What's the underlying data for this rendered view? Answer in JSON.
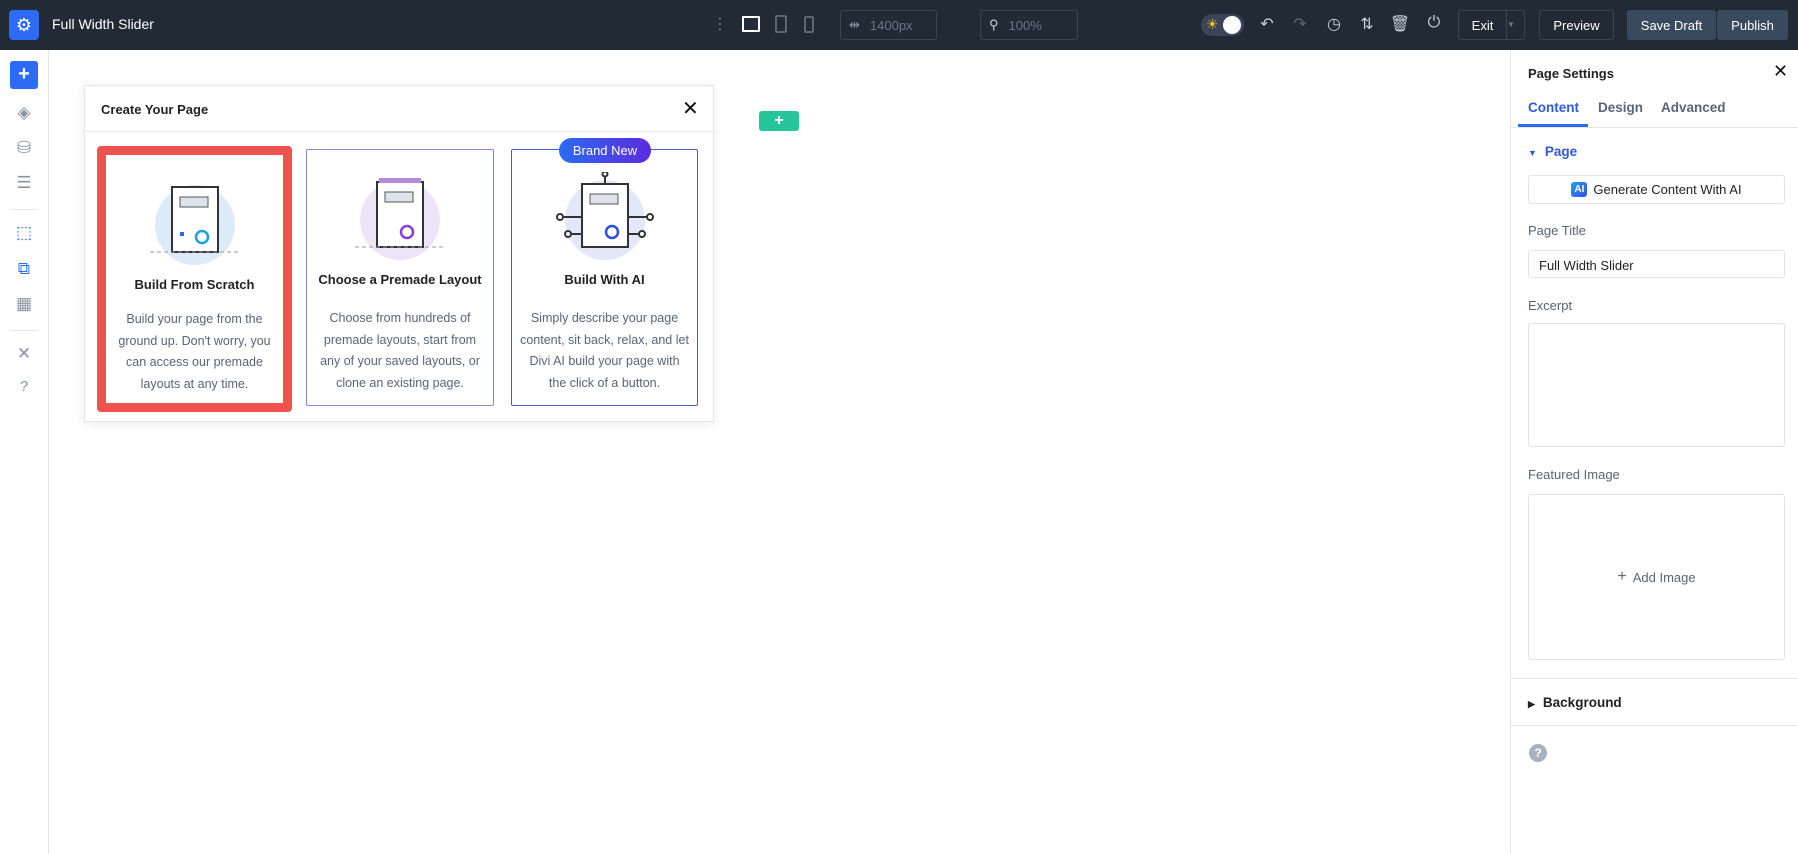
{
  "topbar": {
    "title": "Full Width Slider",
    "width_value": "1400px",
    "zoom_value": "100%",
    "exit_label": "Exit",
    "preview_label": "Preview",
    "save_draft_label": "Save Draft",
    "publish_label": "Publish"
  },
  "modal": {
    "title": "Create Your Page",
    "cards": [
      {
        "title": "Build From Scratch",
        "description": "Build your page from the ground up. Don't worry, you can access our premade layouts at any time."
      },
      {
        "title": "Choose a Premade Layout",
        "description": "Choose from hundreds of premade layouts, start from any of your saved layouts, or clone an existing page."
      },
      {
        "title": "Build With AI",
        "badge": "Brand New",
        "description": "Simply describe your page content, sit back, relax, and let Divi AI build your page with the click of a button."
      }
    ]
  },
  "panel": {
    "title": "Page Settings",
    "tabs": [
      "Content",
      "Design",
      "Advanced"
    ],
    "section_page": "Page",
    "ai_icon": "AI",
    "ai_button": "Generate Content With AI",
    "page_title_label": "Page Title",
    "page_title_value": "Full Width Slider",
    "excerpt_label": "Excerpt",
    "featured_image_label": "Featured Image",
    "add_image": "Add Image",
    "section_background": "Background"
  },
  "colors": {
    "accent": "#2d6bf5",
    "topbar": "#222a36",
    "highlight": "#ef5350",
    "green": "#27c59a"
  }
}
